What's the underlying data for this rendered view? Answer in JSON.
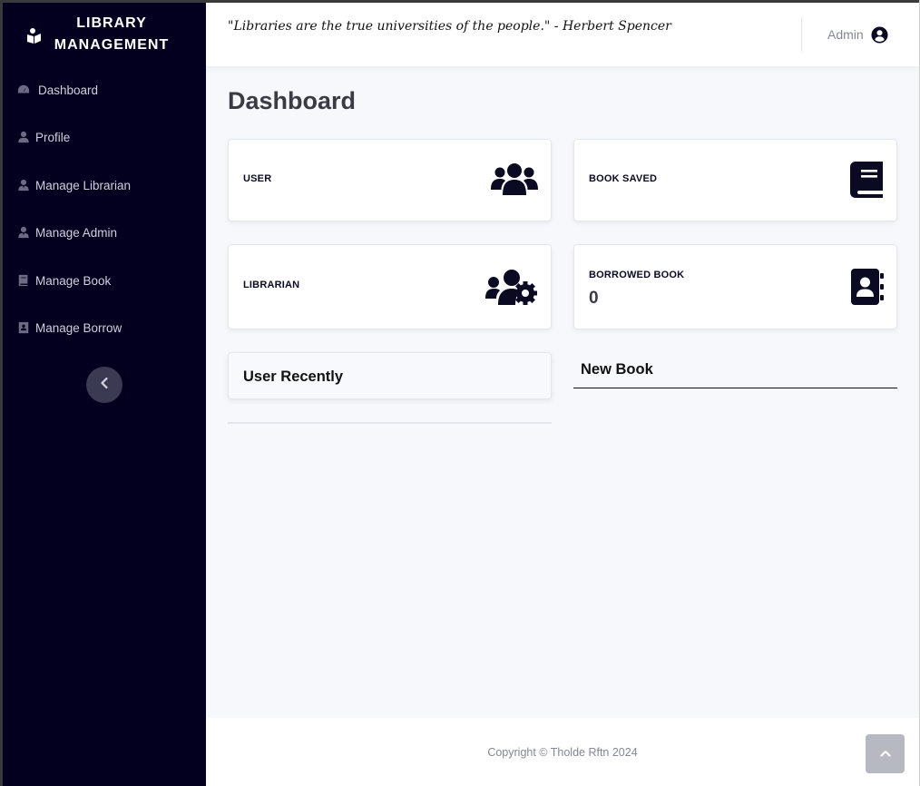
{
  "brand": {
    "line1": "LIBRARY",
    "line2": "MANAGEMENT",
    "icon": "book-reader-icon"
  },
  "sidebar": {
    "items": [
      {
        "label": "Dashboard",
        "icon": "tachometer-icon"
      },
      {
        "label": "Profile",
        "icon": "user-icon"
      },
      {
        "label": "Manage Librarian",
        "icon": "user-tie-icon"
      },
      {
        "label": "Manage Admin",
        "icon": "user-tie-icon"
      },
      {
        "label": "Manage Book",
        "icon": "book-icon"
      },
      {
        "label": "Manage Borrow",
        "icon": "address-book-icon"
      }
    ],
    "collapse_icon": "chevron-left-icon"
  },
  "topbar": {
    "quote": "\"Libraries are the true universities of the people.\" - Herbert Spencer",
    "user_name": "Admin",
    "user_icon": "user-circle-icon"
  },
  "page": {
    "title": "Dashboard"
  },
  "cards": [
    {
      "label": "USER",
      "value": "",
      "icon": "users-icon"
    },
    {
      "label": "BOOK SAVED",
      "value": "",
      "icon": "book-icon"
    },
    {
      "label": "LIBRARIAN",
      "value": "",
      "icon": "users-cog-icon"
    },
    {
      "label": "BORROWED BOOK",
      "value": "0",
      "icon": "address-book-icon"
    }
  ],
  "panels": {
    "user_recently": {
      "title": "User Recently"
    },
    "new_book": {
      "title": "New Book"
    }
  },
  "footer": {
    "copyright": "Copyright © Tholde Rftn 2024"
  },
  "colors": {
    "sidebar_bg": "#03001f",
    "accent_dark": "#0b0a23",
    "page_bg": "#f7f8fc"
  }
}
